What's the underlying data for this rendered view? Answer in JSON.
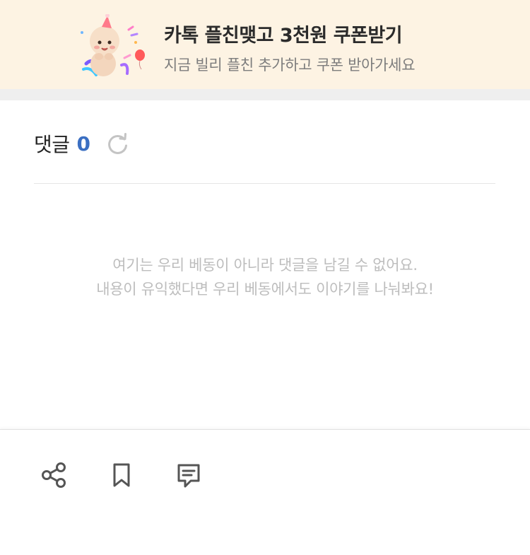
{
  "promo": {
    "title": "카톡 플친맺고 3천원 쿠폰받기",
    "subtitle": "지금 빌리 플친 추가하고 쿠폰 받아가세요",
    "illustration": "baby-mascot-celebration"
  },
  "comments": {
    "label": "댓글",
    "count": "0",
    "refresh_icon": "refresh-icon",
    "empty_line1": "여기는 우리 베동이 아니라 댓글을 남길 수 없어요.",
    "empty_line2": "내용이 유익했다면 우리 베동에서도 이야기를 나눠봐요!"
  },
  "actions": {
    "share_icon": "share-icon",
    "bookmark_icon": "bookmark-icon",
    "comment_icon": "comment-icon"
  },
  "colors": {
    "banner_bg": "#fdf3e3",
    "count_accent": "#3b6fc2",
    "muted_text": "#bdbdbd",
    "icon": "#555555"
  }
}
